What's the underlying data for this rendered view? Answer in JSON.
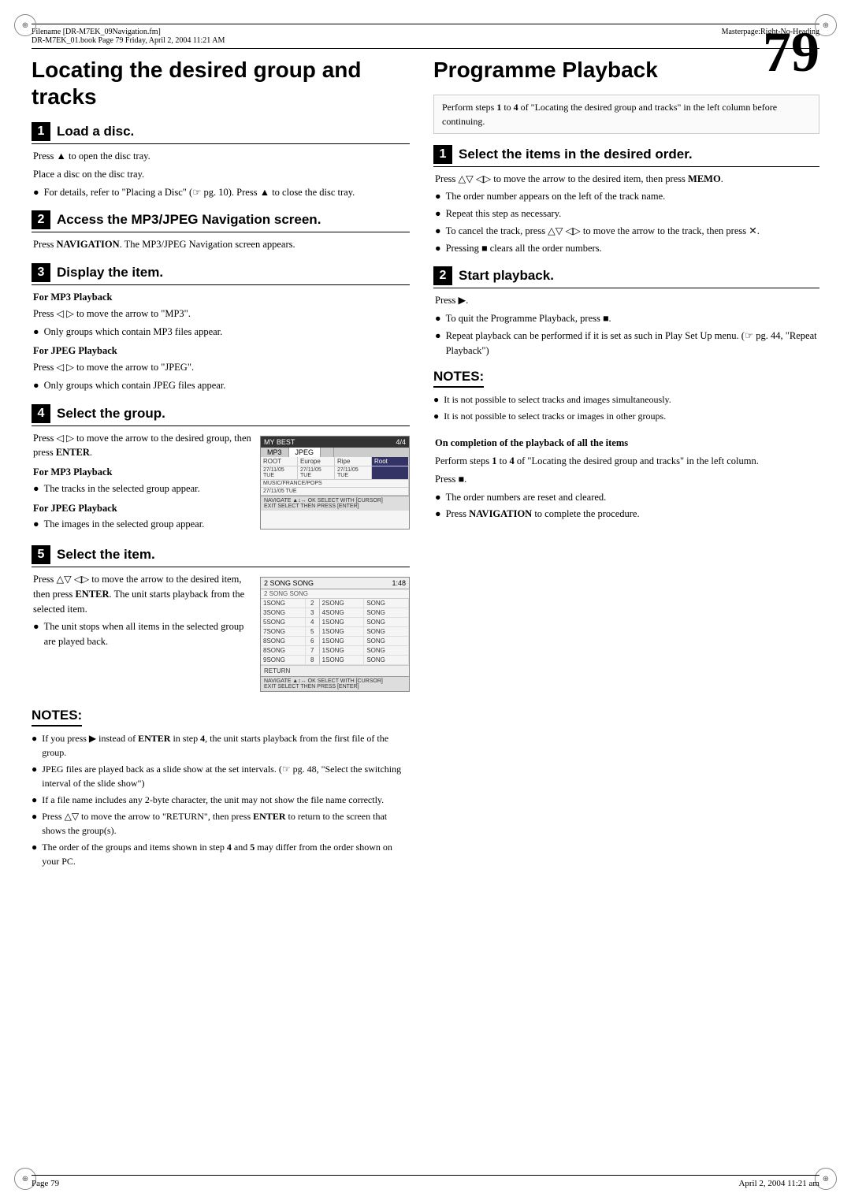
{
  "header": {
    "left_top": "Filename [DR-M7EK_09Navigation.fm]",
    "left_bottom": "DR-M7EK_01.book  Page 79  Friday, April 2, 2004  11:21 AM",
    "right": "Masterpage:Right-No-Heading"
  },
  "page_number": "79",
  "left_column": {
    "title": "Locating the desired group and tracks",
    "steps": [
      {
        "number": "1",
        "title": "Load a disc.",
        "content": [
          "Press ▲ to open the disc tray.",
          "Place a disc on the disc tray."
        ],
        "bullets": [
          "For details, refer to \"Placing a Disc\" (☞ pg. 10). Press ▲ to close the disc tray."
        ]
      },
      {
        "number": "2",
        "title": "Access the MP3/JPEG Navigation screen.",
        "content": [
          "Press NAVIGATION. The MP3/JPEG Navigation screen appears."
        ],
        "bullets": []
      },
      {
        "number": "3",
        "title": "Display the item.",
        "content": [],
        "sub_sections": [
          {
            "label": "For MP3 Playback",
            "text": "Press ◁ ▷ to move the arrow to \"MP3\".",
            "bullets": [
              "Only groups which contain MP3 files appear."
            ]
          },
          {
            "label": "For JPEG Playback",
            "text": "Press ◁ ▷ to move the arrow to \"JPEG\".",
            "bullets": [
              "Only groups which contain JPEG files appear."
            ]
          }
        ]
      },
      {
        "number": "4",
        "title": "Select the group.",
        "has_screen": true,
        "content_left": [
          "Press ◁ ▷ to move the arrow to the desired group, then press ENTER."
        ],
        "sub_sections": [
          {
            "label": "For MP3 Playback",
            "bullets": [
              "The tracks in the selected group appear."
            ]
          },
          {
            "label": "For JPEG Playback",
            "bullets": [
              "The images in the selected group appear."
            ]
          }
        ]
      },
      {
        "number": "5",
        "title": "Select the item.",
        "has_screen2": true,
        "content": [
          "Press △▽ ◁▷ to move the arrow to the desired item, then press ENTER. The unit starts playback from the selected item."
        ],
        "bullets": [
          "The unit stops when all items in the selected group are played back."
        ]
      }
    ],
    "notes": {
      "title": "NOTES:",
      "items": [
        "If you press ▶ instead of ENTER in step 4, the unit starts playback from the first file of the group.",
        "JPEG files are played back as a slide show at the set intervals. (☞ pg. 48, \"Select the switching interval of the slide show\")",
        "If a file name includes any 2-byte character, the unit may not show the file name correctly.",
        "Press △▽ to move the arrow to \"RETURN\", then press ENTER to return to the screen that shows the group(s).",
        "The order of the groups and items shown in step 4 and 5 may differ from the order shown on your PC."
      ]
    }
  },
  "right_column": {
    "title": "Programme Playback",
    "intro": "Perform steps 1 to 4 of \"Locating the desired group and tracks\" in the left column before continuing.",
    "steps": [
      {
        "number": "1",
        "title": "Select the items in the desired order.",
        "content": [
          "Press △▽ ◁▷ to move the arrow to the desired item, then press MEMO."
        ],
        "bullets": [
          "The order number appears on the left of the track name.",
          "Repeat this step as necessary.",
          "To cancel the track, press △▽ ◁▷ to move the arrow to the track, then press ✕.",
          "Pressing ■ clears all the order numbers."
        ]
      },
      {
        "number": "2",
        "title": "Start playback.",
        "content": [
          "Press ▶."
        ],
        "bullets": [
          "To quit the Programme Playback, press ■.",
          "Repeat playback can be performed if it is set as such in Play Set Up menu. (☞ pg. 44, \"Repeat Playback\")"
        ]
      }
    ],
    "notes": {
      "title": "NOTES:",
      "items": [
        "It is not possible to select tracks and images simultaneously.",
        "It is not possible to select tracks or images in other groups."
      ]
    },
    "completion": {
      "heading": "On completion of the playback of all the items",
      "content": "Perform steps 1 to 4 of \"Locating the desired group and tracks\" in the left column.",
      "press": "Press ■.",
      "bullets": [
        "The order numbers are reset and cleared.",
        "Press NAVIGATION to complete the procedure."
      ]
    }
  },
  "footer": {
    "left": "Page 79",
    "right": "April 2, 2004  11:21 am"
  },
  "screen1": {
    "title": "MY BEST",
    "tabs": [
      "MP3",
      "JPEG",
      "",
      "4/4"
    ],
    "rows": [
      [
        "ROOT",
        "Europe",
        "Ripe",
        "Root"
      ],
      [
        "27/11/05 TUE",
        "27/11/05 TUE",
        "27/11/05 TUE"
      ],
      [
        "MUSIC/FRANCE/POPS"
      ],
      [
        "27/11/05 TUE"
      ]
    ],
    "footer": "NAVIGATE ▲↕↔  OK  SELECT WITH [CURSOR]",
    "footer2": "EXIT  SELECT  THEN PRESS [ENTER]"
  },
  "screen2": {
    "title": "2 SONG SONG",
    "subtitle": "2 SONG SONG",
    "time": "1:48",
    "rows": [
      [
        "1SONG",
        "2",
        "2SONG",
        "SONG"
      ],
      [
        "3SONG",
        "3",
        "4SONG",
        "SONG"
      ],
      [
        "5SONG",
        "4",
        "1SONG",
        "SONG"
      ],
      [
        "7SONG",
        "5",
        "1SONG",
        "SONG"
      ],
      [
        "8SONG",
        "6",
        "1SONG",
        "SONG"
      ],
      [
        "8SONG",
        "7",
        "1SONG",
        "SONG"
      ],
      [
        "9SONG",
        "8",
        "1SONG",
        "SONG"
      ]
    ],
    "return_btn": "RETURN",
    "footer": "NAVIGATE ▲↕↔  OK  SELECT WITH [CURSOR]",
    "footer2": "EXIT  SELECT  THEN PRESS [ENTER]"
  }
}
